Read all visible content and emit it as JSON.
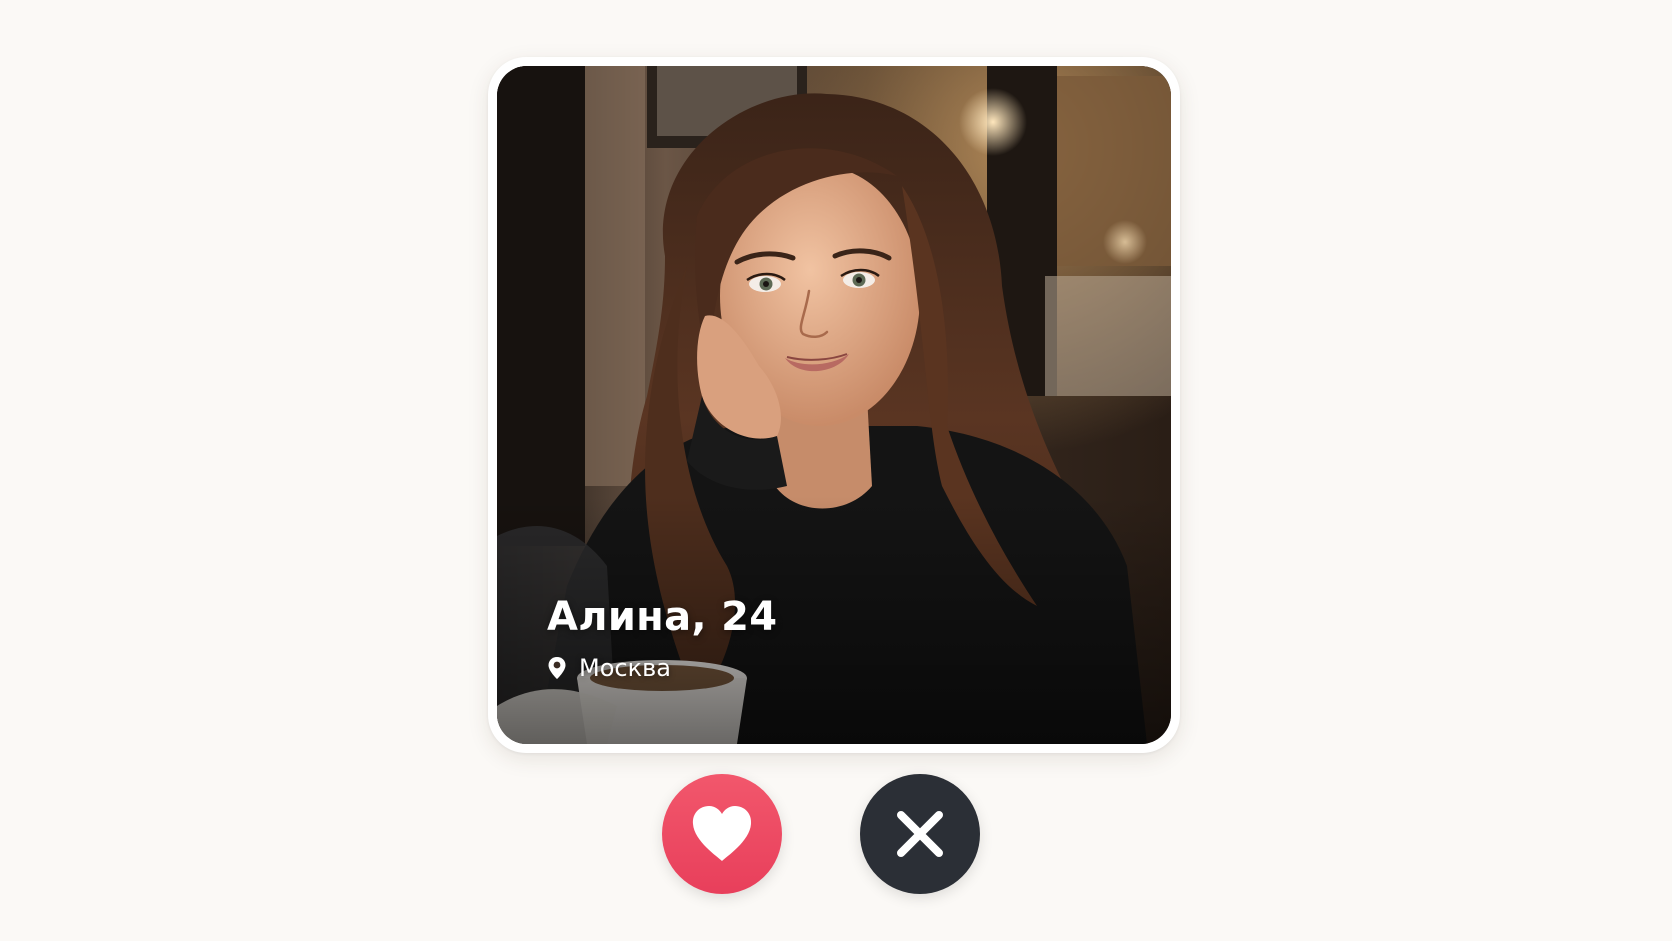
{
  "profile": {
    "name_age": "Алина, 24",
    "location": "Москва",
    "photo_alt": "Фото профиля"
  },
  "actions": {
    "like_label": "Нравится",
    "pass_label": "Пропустить"
  },
  "icons": {
    "location": "location-pin-icon",
    "like": "heart-icon",
    "pass": "close-icon"
  },
  "colors": {
    "background": "#fbf9f6",
    "like_button": "#ec4863",
    "pass_button": "#2b2f36",
    "text_on_photo": "#ffffff"
  }
}
